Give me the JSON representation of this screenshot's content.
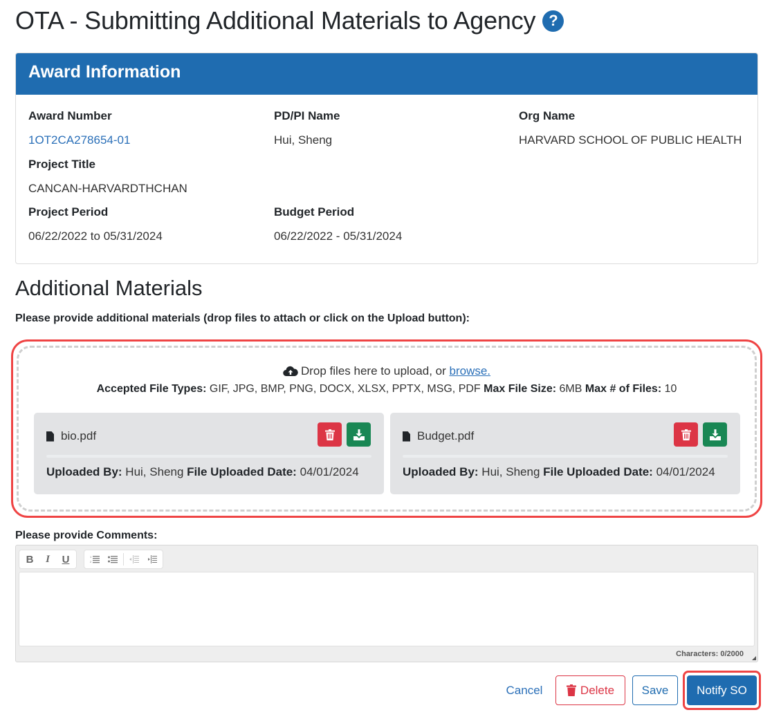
{
  "page": {
    "title": "OTA - Submitting Additional Materials to Agency",
    "help_icon": "question-circle-icon"
  },
  "award_info": {
    "header": "Award Information",
    "fields": {
      "award_number": {
        "label": "Award Number",
        "value": "1OT2CA278654-01"
      },
      "pdpi_name": {
        "label": "PD/PI Name",
        "value": "Hui, Sheng"
      },
      "org_name": {
        "label": "Org Name",
        "value": "HARVARD SCHOOL OF PUBLIC HEALTH"
      },
      "project_title": {
        "label": "Project Title",
        "value": "CANCAN-HARVARDTHCHAN"
      },
      "project_period": {
        "label": "Project Period",
        "value": "06/22/2022 to 05/31/2024"
      },
      "budget_period": {
        "label": "Budget Period",
        "value": "06/22/2022 - 05/31/2024"
      }
    }
  },
  "materials": {
    "title": "Additional Materials",
    "instructions": "Please provide additional materials (drop files to attach or click on the Upload button):",
    "dropzone": {
      "icon": "cloud-upload-icon",
      "text": "Drop files here to upload, or",
      "browse_label": "browse.",
      "accepted_label": "Accepted File Types:",
      "accepted_value": "GIF, JPG, BMP, PNG, DOCX, XLSX, PPTX, MSG, PDF",
      "max_size_label": "Max File Size:",
      "max_size_value": "6MB",
      "max_files_label": "Max # of Files:",
      "max_files_value": "10"
    },
    "files": [
      {
        "name": "bio.pdf",
        "uploaded_by_label": "Uploaded By:",
        "uploaded_by": "Hui, Sheng",
        "date_label": "File Uploaded Date:",
        "date": "04/01/2024"
      },
      {
        "name": "Budget.pdf",
        "uploaded_by_label": "Uploaded By:",
        "uploaded_by": "Hui, Sheng",
        "date_label": "File Uploaded Date:",
        "date": "04/01/2024"
      }
    ]
  },
  "comments": {
    "label": "Please provide Comments:",
    "toolbar": {
      "bold": "B",
      "italic": "I",
      "underline": "U"
    },
    "value": "",
    "char_count": "Characters: 0/2000"
  },
  "actions": {
    "cancel": "Cancel",
    "delete": "Delete",
    "save": "Save",
    "notify": "Notify SO"
  },
  "colors": {
    "primary": "#1f6cb0",
    "danger": "#dc3545",
    "success": "#198754",
    "highlight": "#ef4444"
  }
}
